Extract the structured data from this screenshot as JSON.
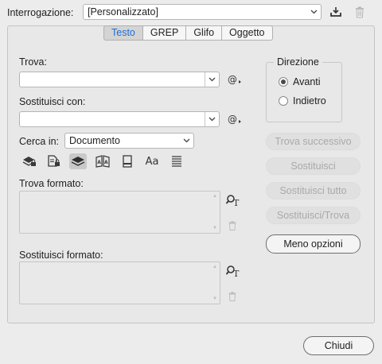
{
  "query": {
    "label": "Interrogazione:",
    "value": "[Personalizzato]"
  },
  "tabs": [
    {
      "label": "Testo",
      "active": true
    },
    {
      "label": "GREP",
      "active": false
    },
    {
      "label": "Glifo",
      "active": false
    },
    {
      "label": "Oggetto",
      "active": false
    }
  ],
  "find": {
    "label": "Trova:",
    "value": ""
  },
  "replace": {
    "label": "Sostituisci con:",
    "value": ""
  },
  "search_in": {
    "label": "Cerca in:",
    "value": "Documento"
  },
  "toolbar_icons": [
    "include-locked-layers-icon",
    "include-locked-stories-icon",
    "include-hidden-layers-icon",
    "include-master-pages-icon",
    "include-footnotes-icon",
    "case-sensitive-icon",
    "whole-word-icon"
  ],
  "toolbar_text": {
    "case_sensitive": "Aa"
  },
  "find_format": {
    "label": "Trova formato:"
  },
  "replace_format": {
    "label": "Sostituisci formato:"
  },
  "direction": {
    "label": "Direzione",
    "options": [
      {
        "label": "Avanti",
        "checked": true
      },
      {
        "label": "Indietro",
        "checked": false
      }
    ]
  },
  "actions": {
    "find_next": "Trova successivo",
    "replace": "Sostituisci",
    "replace_all": "Sostituisci tutto",
    "replace_find": "Sostituisci/Trova",
    "fewer_options": "Meno opzioni"
  },
  "close": "Chiudi",
  "colors": {
    "accent": "#1a6fd6",
    "disabled_text": "#a9a9a9"
  }
}
